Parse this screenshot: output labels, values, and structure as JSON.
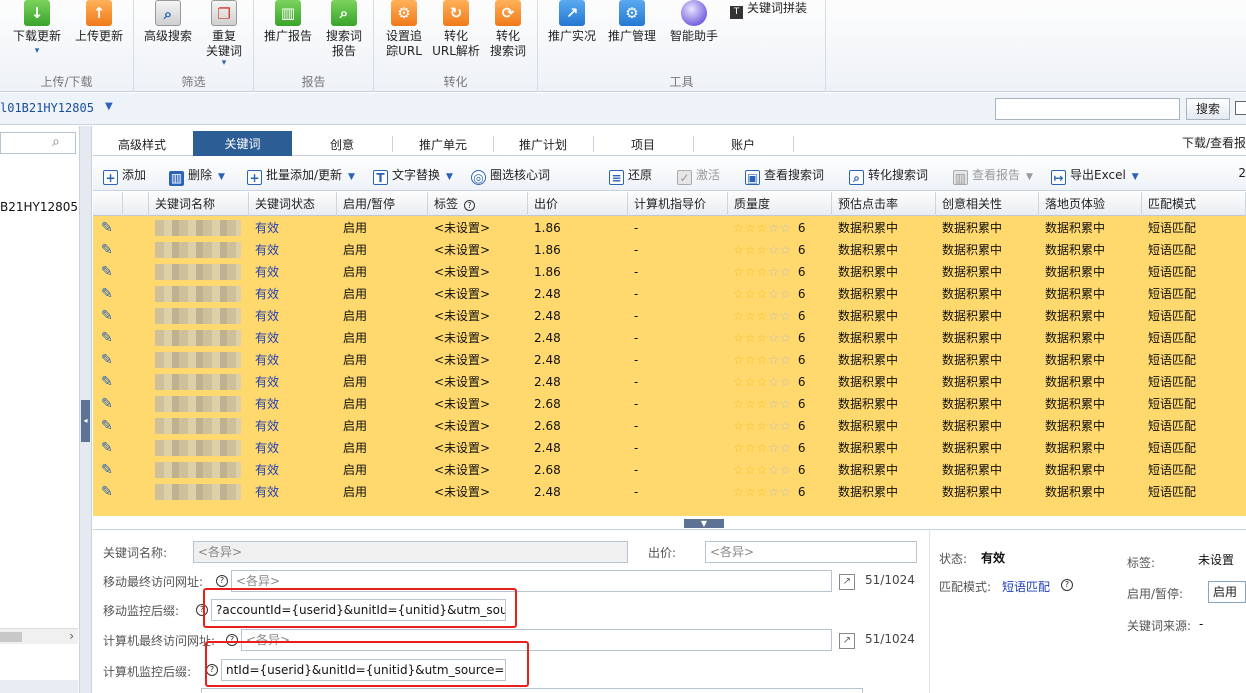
{
  "ribbon": {
    "groups": [
      {
        "title": "上传/下载",
        "buttons": [
          {
            "label1": "下载更新",
            "label2": "",
            "icon": "download-arrow-icon",
            "dd": true
          },
          {
            "label1": "上传更新",
            "label2": "",
            "icon": "upload-arrow-icon",
            "dd": false
          }
        ]
      },
      {
        "title": "筛选",
        "buttons": [
          {
            "label1": "高级搜索",
            "label2": "",
            "icon": "magnifier-doc-icon",
            "dd": false
          },
          {
            "label1": "重复",
            "label2": "关键词",
            "icon": "duplicate-keyword-icon",
            "dd": true
          }
        ]
      },
      {
        "title": "报告",
        "buttons": [
          {
            "label1": "推广报告",
            "label2": "",
            "icon": "bar-chart-report-icon",
            "dd": false
          },
          {
            "label1": "搜索词",
            "label2": "报告",
            "icon": "search-term-report-icon",
            "dd": false
          }
        ]
      },
      {
        "title": "转化",
        "buttons": [
          {
            "label1": "设置追",
            "label2": "踪URL",
            "icon": "gear-tracking-icon",
            "dd": false
          },
          {
            "label1": "转化",
            "label2": "URL解析",
            "icon": "refresh-url-icon",
            "dd": false
          },
          {
            "label1": "转化",
            "label2": "搜索词",
            "icon": "convert-search-icon",
            "dd": false
          }
        ]
      },
      {
        "title": "工具",
        "buttons": [
          {
            "label1": "推广实况",
            "label2": "",
            "icon": "share-live-icon",
            "dd": false
          },
          {
            "label1": "推广管理",
            "label2": "",
            "icon": "manage-gear-icon",
            "dd": false
          },
          {
            "label1": "智能助手",
            "label2": "",
            "icon": "globe-assistant-icon",
            "dd": false
          }
        ]
      }
    ],
    "extra_label": "关键词拼装"
  },
  "account": {
    "name": "l01B21HY12805",
    "search_button": "搜索",
    "search_value": ""
  },
  "tree": {
    "node": "B21HY12805",
    "search_value": ""
  },
  "tabs": [
    {
      "label": "高级样式",
      "active": false
    },
    {
      "label": "关键词",
      "active": true
    },
    {
      "label": "创意",
      "active": false
    },
    {
      "label": "推广单元",
      "active": false
    },
    {
      "label": "推广计划",
      "active": false
    },
    {
      "label": "项目",
      "active": false
    },
    {
      "label": "账户",
      "active": false
    }
  ],
  "download_view": "下载/查看报",
  "toolbar": {
    "add": "添加",
    "delete": "删除",
    "batch": "批量添加/更新",
    "replace": "文字替换",
    "core": "圈选核心词",
    "restore": "还原",
    "activate": "激活",
    "view_search": "查看搜索词",
    "convert_search": "转化搜索词",
    "view_report": "查看报告",
    "export": "导出Excel",
    "right_num": "2"
  },
  "grid": {
    "headers": [
      "关键词名称",
      "关键词状态",
      "启用/暂停",
      "标签",
      "出价",
      "计算机指导价",
      "质量度",
      "预估点击率",
      "创意相关性",
      "落地页体验",
      "匹配模式"
    ],
    "rows": [
      {
        "status": "有效",
        "enabled": "启用",
        "tag": "<未设置>",
        "bid": "1.86",
        "guide": "-",
        "stars": 3,
        "quality": "6",
        "ctr": "数据积累中",
        "relevance": "数据积累中",
        "landing": "数据积累中",
        "match": "短语匹配"
      },
      {
        "status": "有效",
        "enabled": "启用",
        "tag": "<未设置>",
        "bid": "1.86",
        "guide": "-",
        "stars": 3,
        "quality": "6",
        "ctr": "数据积累中",
        "relevance": "数据积累中",
        "landing": "数据积累中",
        "match": "短语匹配"
      },
      {
        "status": "有效",
        "enabled": "启用",
        "tag": "<未设置>",
        "bid": "1.86",
        "guide": "-",
        "stars": 3,
        "quality": "6",
        "ctr": "数据积累中",
        "relevance": "数据积累中",
        "landing": "数据积累中",
        "match": "短语匹配"
      },
      {
        "status": "有效",
        "enabled": "启用",
        "tag": "<未设置>",
        "bid": "2.48",
        "guide": "-",
        "stars": 3,
        "quality": "6",
        "ctr": "数据积累中",
        "relevance": "数据积累中",
        "landing": "数据积累中",
        "match": "短语匹配"
      },
      {
        "status": "有效",
        "enabled": "启用",
        "tag": "<未设置>",
        "bid": "2.48",
        "guide": "-",
        "stars": 3,
        "quality": "6",
        "ctr": "数据积累中",
        "relevance": "数据积累中",
        "landing": "数据积累中",
        "match": "短语匹配"
      },
      {
        "status": "有效",
        "enabled": "启用",
        "tag": "<未设置>",
        "bid": "2.48",
        "guide": "-",
        "stars": 3,
        "quality": "6",
        "ctr": "数据积累中",
        "relevance": "数据积累中",
        "landing": "数据积累中",
        "match": "短语匹配"
      },
      {
        "status": "有效",
        "enabled": "启用",
        "tag": "<未设置>",
        "bid": "2.48",
        "guide": "-",
        "stars": 3,
        "quality": "6",
        "ctr": "数据积累中",
        "relevance": "数据积累中",
        "landing": "数据积累中",
        "match": "短语匹配"
      },
      {
        "status": "有效",
        "enabled": "启用",
        "tag": "<未设置>",
        "bid": "2.48",
        "guide": "-",
        "stars": 3,
        "quality": "6",
        "ctr": "数据积累中",
        "relevance": "数据积累中",
        "landing": "数据积累中",
        "match": "短语匹配"
      },
      {
        "status": "有效",
        "enabled": "启用",
        "tag": "<未设置>",
        "bid": "2.68",
        "guide": "-",
        "stars": 3,
        "quality": "6",
        "ctr": "数据积累中",
        "relevance": "数据积累中",
        "landing": "数据积累中",
        "match": "短语匹配"
      },
      {
        "status": "有效",
        "enabled": "启用",
        "tag": "<未设置>",
        "bid": "2.68",
        "guide": "-",
        "stars": 3,
        "quality": "6",
        "ctr": "数据积累中",
        "relevance": "数据积累中",
        "landing": "数据积累中",
        "match": "短语匹配"
      },
      {
        "status": "有效",
        "enabled": "启用",
        "tag": "<未设置>",
        "bid": "2.48",
        "guide": "-",
        "stars": 3,
        "quality": "6",
        "ctr": "数据积累中",
        "relevance": "数据积累中",
        "landing": "数据积累中",
        "match": "短语匹配"
      },
      {
        "status": "有效",
        "enabled": "启用",
        "tag": "<未设置>",
        "bid": "2.68",
        "guide": "-",
        "stars": 3,
        "quality": "6",
        "ctr": "数据积累中",
        "relevance": "数据积累中",
        "landing": "数据积累中",
        "match": "短语匹配"
      },
      {
        "status": "有效",
        "enabled": "启用",
        "tag": "<未设置>",
        "bid": "2.48",
        "guide": "-",
        "stars": 3,
        "quality": "6",
        "ctr": "数据积累中",
        "relevance": "数据积累中",
        "landing": "数据积累中",
        "match": "短语匹配"
      }
    ]
  },
  "detail": {
    "kw_name_label": "关键词名称:",
    "kw_name_value": "<各异>",
    "bid_label": "出价:",
    "bid_value": "<各异>",
    "mobile_url_label": "移动最终访问网址:",
    "mobile_url_value": "<各异>",
    "mobile_url_count": "51/1024",
    "mobile_suffix_label": "移动监控后缀:",
    "mobile_suffix_value": "?accountId={userid}&unitId={unitid}&utm_source=",
    "pc_url_label": "计算机最终访问网址:",
    "pc_url_value": "<各异>",
    "pc_url_count": "51/1024",
    "pc_suffix_label": "计算机监控后缀:",
    "pc_suffix_value": "ntId={userid}&unitId={unitid}&utm_source=百度"
  },
  "side": {
    "status_label": "状态:",
    "status_value": "有效",
    "match_label": "匹配模式:",
    "match_value": "短语匹配",
    "tag_label": "标签:",
    "tag_value": "未设置",
    "enable_label": "启用/暂停:",
    "enable_value": "启用",
    "source_label": "关键词来源:",
    "source_value": "-"
  },
  "colors": {
    "row_bg": "#ffd86e",
    "tab_active": "#2d5d95",
    "highlight_box": "#e8201c",
    "link": "#1f3fb8"
  }
}
